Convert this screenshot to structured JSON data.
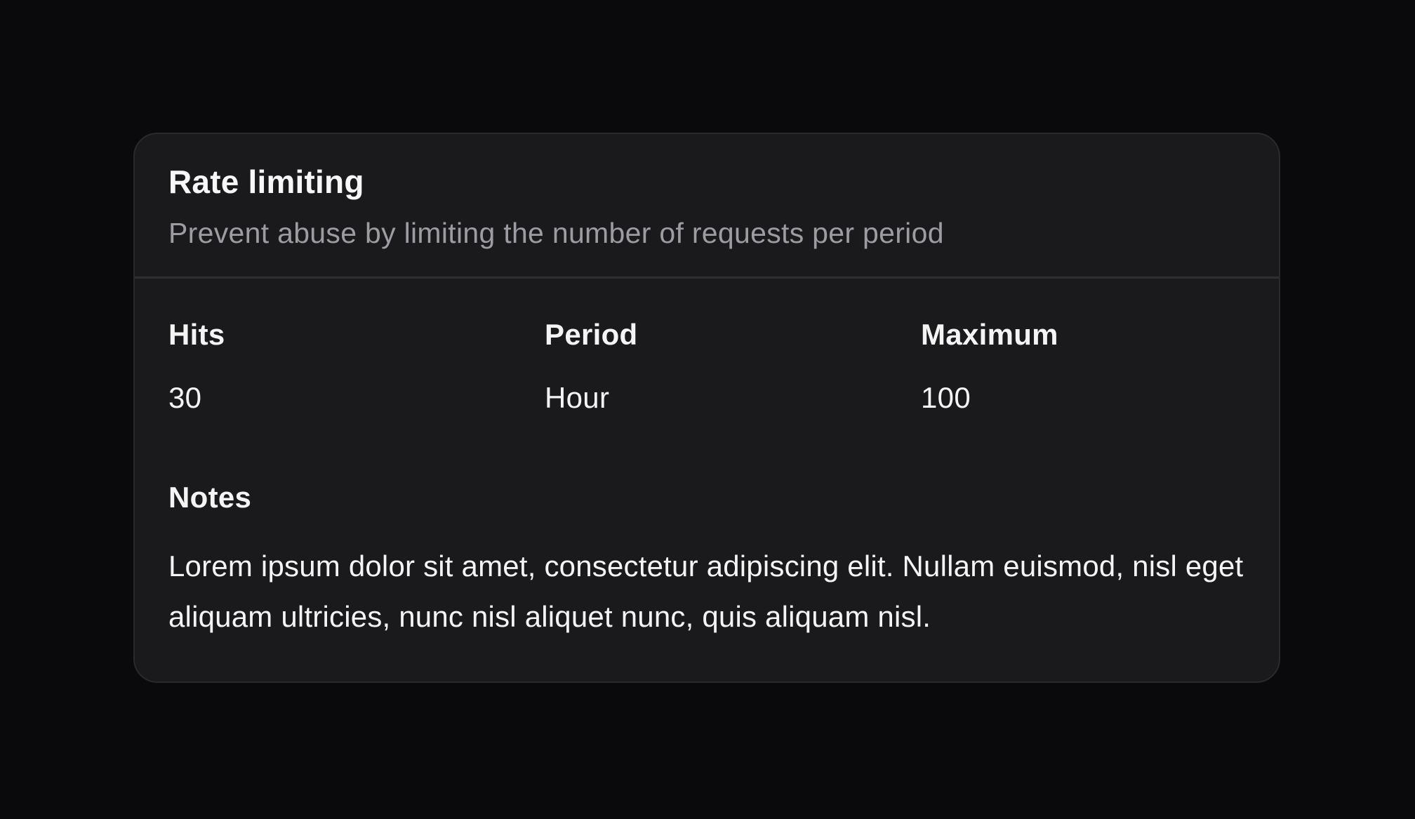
{
  "card": {
    "title": "Rate limiting",
    "description": "Prevent abuse by limiting the number of requests per period",
    "fields": [
      {
        "label": "Hits",
        "value": "30"
      },
      {
        "label": "Period",
        "value": "Hour"
      },
      {
        "label": "Maximum",
        "value": "100"
      }
    ],
    "notes": {
      "label": "Notes",
      "text": "Lorem ipsum dolor sit amet, consectetur adipiscing elit. Nullam euismod, nisl eget aliquam ultricies, nunc nisl aliquet nunc, quis aliquam nisl."
    }
  },
  "colors": {
    "background": "#0a0a0c",
    "card": "#1a1a1c",
    "border": "#2a2a2d",
    "text": "#f4f4f5",
    "muted": "#9c9ca3"
  }
}
